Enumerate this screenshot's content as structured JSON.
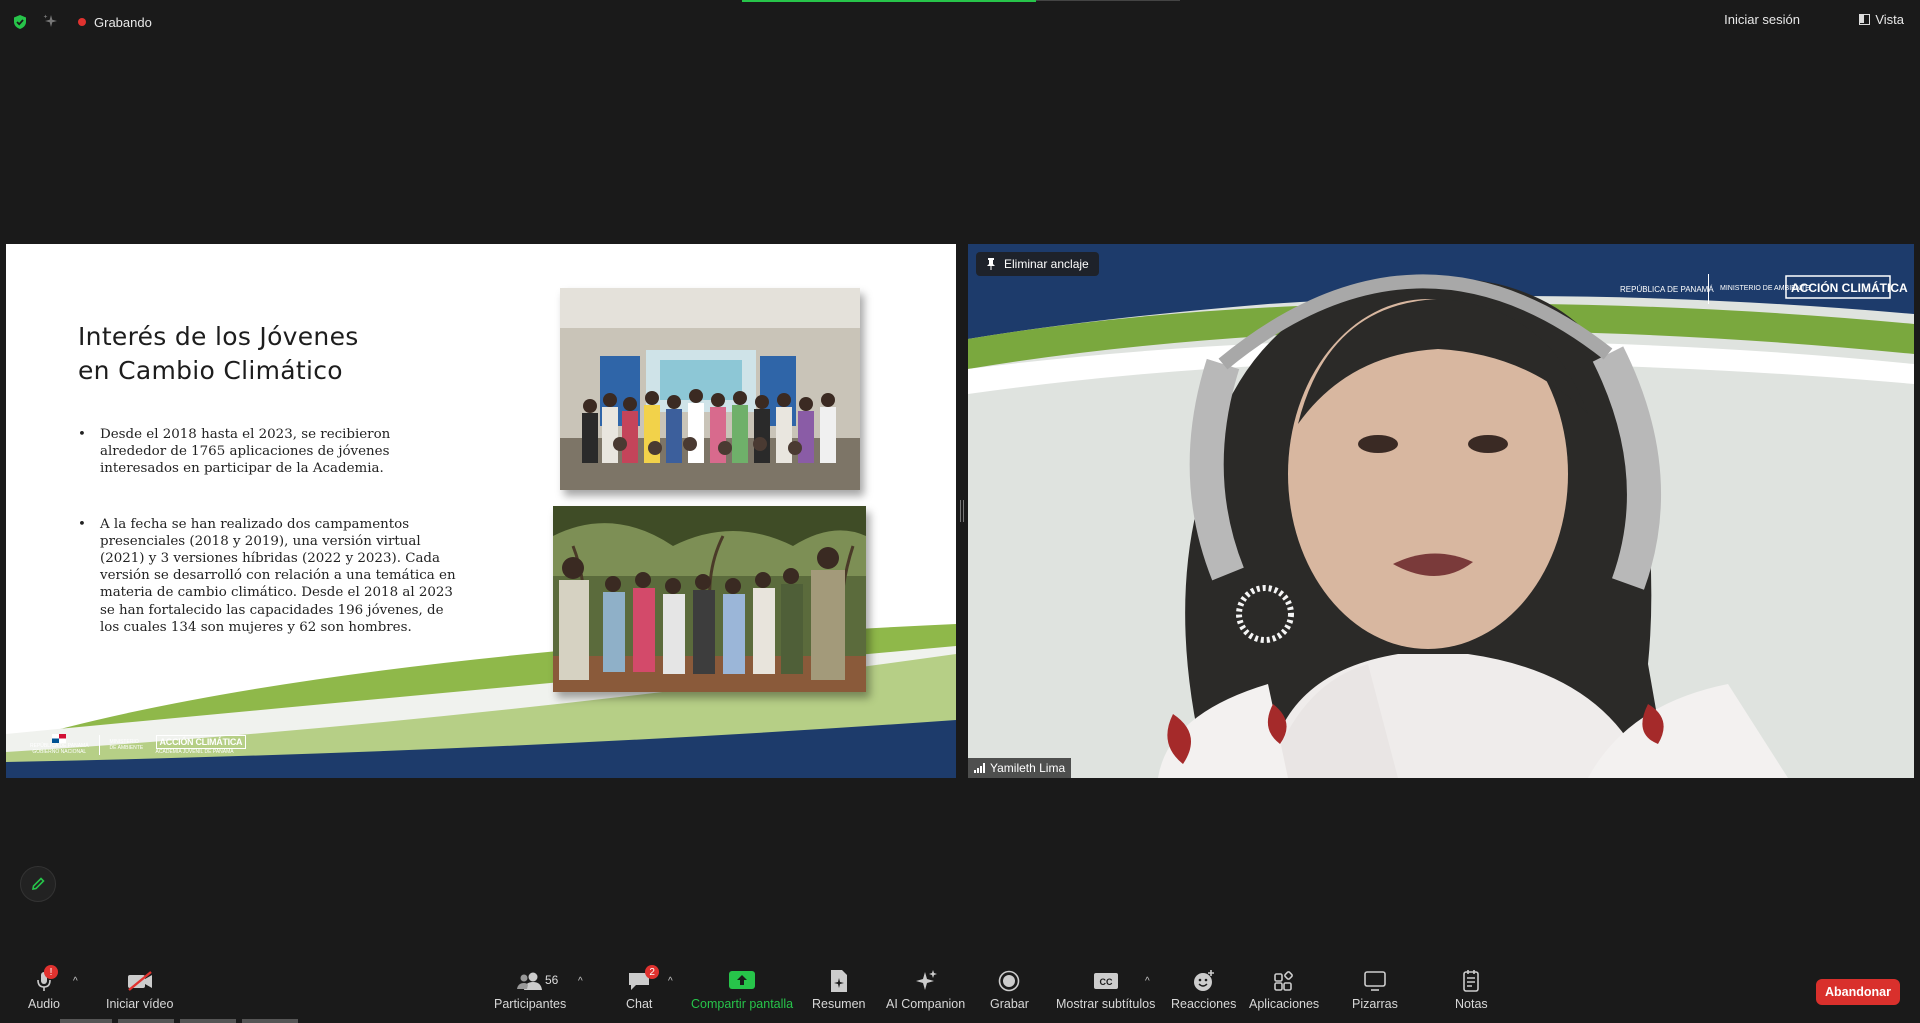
{
  "topbar": {
    "recording_label": "Grabando",
    "signin_label": "Iniciar sesión",
    "view_label": "Vista"
  },
  "slide": {
    "title_line1": "Interés de los Jóvenes",
    "title_line2": "en Cambio Climático",
    "bullets": [
      "Desde el 2018 hasta el 2023, se recibieron alrededor de 1765 aplicaciones de jóvenes interesados en participar de la Academia.",
      "A la fecha se han realizado dos campamentos presenciales (2018 y 2019), una versión virtual (2021) y 3 versiones híbridas (2022 y 2023). Cada versión se desarrolló con relación a una temática en materia de cambio climático. Desde el 2018 al 2023 se han fortalecido las capacidades 196 jóvenes, de los cuales 134 son mujeres y 62 son hombres."
    ],
    "logo_republica": "REPÚBLICA DE PANAMÁ",
    "logo_gobierno": "GOBIERNO NACIONAL",
    "logo_ministerio": "MINISTERIO DE AMBIENTE",
    "logo_accion": "ACCIÓN CLIMÁTICA",
    "logo_academia": "ACADEMIA JUVENIL DE PANAMÁ"
  },
  "video": {
    "unpin_label": "Eliminar anclaje",
    "participant_name": "Yamileth Lima",
    "bg_republica": "REPÚBLICA DE PANAMÁ",
    "bg_ministerio": "MINISTERIO DE AMBIENTE",
    "bg_accion": "ACCIÓN CLIMÁTICA"
  },
  "toolbar": {
    "audio": "Audio",
    "audio_badge": "!",
    "video": "Iniciar vídeo",
    "participants": "Participantes",
    "participants_count": "56",
    "chat": "Chat",
    "chat_badge": "2",
    "share": "Compartir pantalla",
    "summary": "Resumen",
    "ai": "AI Companion",
    "record": "Grabar",
    "captions": "Mostrar subtítulos",
    "captions_icon": "CC",
    "reactions": "Reacciones",
    "apps": "Aplicaciones",
    "whiteboards": "Pizarras",
    "notes": "Notas",
    "leave": "Abandonar"
  },
  "colors": {
    "background": "#1a1a1a",
    "share_green": "#27c44a",
    "leave_red": "#d9302c",
    "recording_red": "#e0322f",
    "slide_navy": "#1d3b6b",
    "slide_green": "#8fb84a"
  }
}
